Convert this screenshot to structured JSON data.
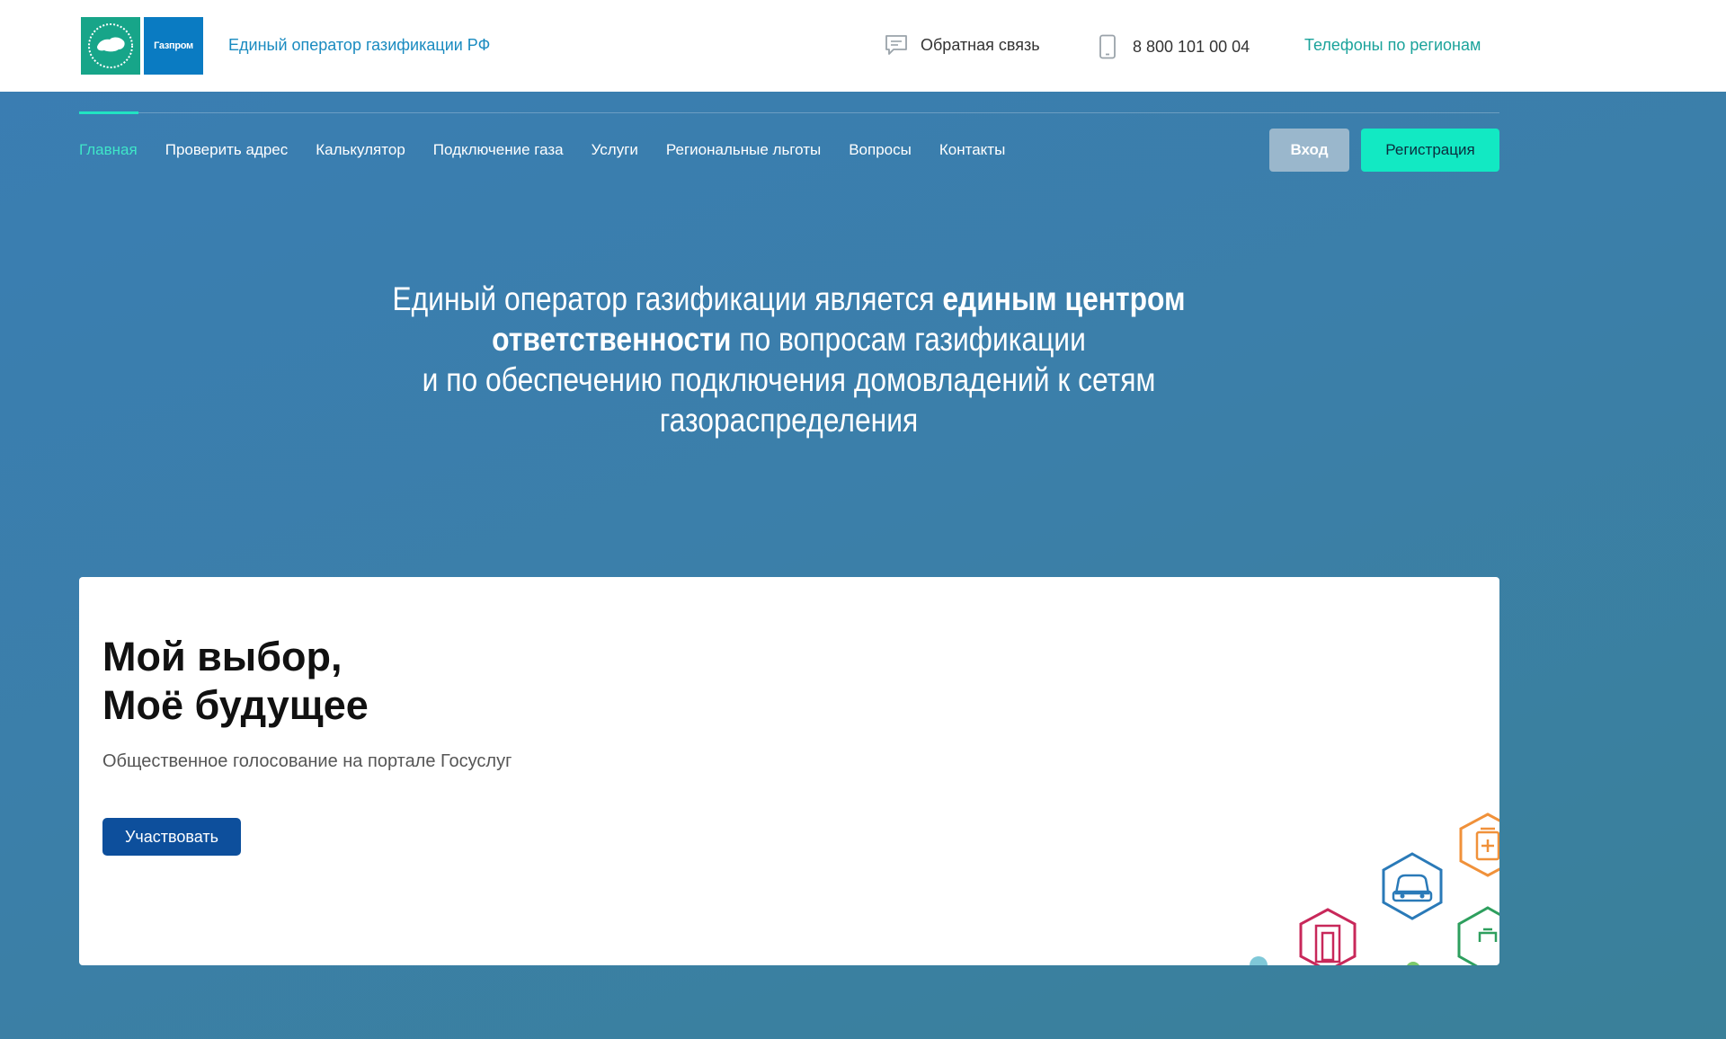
{
  "header": {
    "logo_left_icon": "gazification-russia-map-logo",
    "logo_right_text": "Газпром",
    "site_title": "Единый оператор газификации РФ",
    "feedback_icon": "chat-icon",
    "feedback_label": "Обратная связь",
    "phone_icon": "mobile-phone-icon",
    "phone_number": "8 800 101 00 04",
    "regions_link": "Телефоны по регионам"
  },
  "nav": {
    "items": [
      {
        "label": "Главная",
        "active": true
      },
      {
        "label": "Проверить адрес",
        "active": false
      },
      {
        "label": "Калькулятор",
        "active": false
      },
      {
        "label": "Подключение газа",
        "active": false
      },
      {
        "label": "Услуги",
        "active": false
      },
      {
        "label": "Региональные льготы",
        "active": false
      },
      {
        "label": "Вопросы",
        "active": false
      },
      {
        "label": "Контакты",
        "active": false
      }
    ],
    "login_label": "Вход",
    "register_label": "Регистрация"
  },
  "hero": {
    "line1_normal": "Единый оператор газификации является ",
    "line1_bold": "единым центром",
    "line2_bold": "ответственности",
    "line2_normal": " по вопросам газификации",
    "line3": "и по обеспечению подключения домовладений к сетям",
    "line4": "газораспределения"
  },
  "promo": {
    "title_line1": "Мой выбор,",
    "title_line2": "Моё будущее",
    "subtitle": "Общественное голосование на портале Госуслуг",
    "button_label": "Участвовать"
  },
  "colors": {
    "accent": "#12e9c3",
    "nav_active": "#3fe6c8",
    "brand_blue": "#0d4f9c",
    "header_title": "#1a8bc0"
  }
}
